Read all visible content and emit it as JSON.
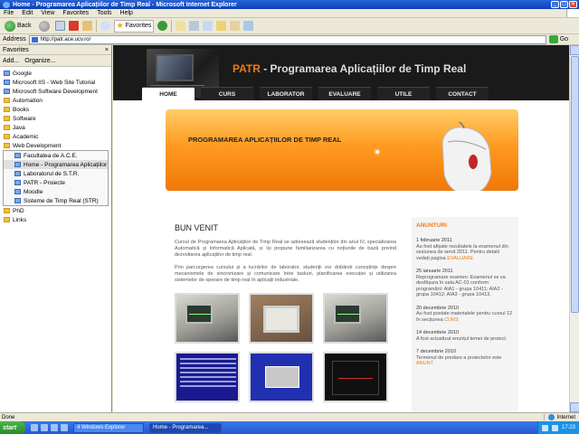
{
  "window": {
    "title": "Home - Programarea Aplicațiilor de Timp Real - Microsoft Internet Explorer"
  },
  "menu": [
    "File",
    "Edit",
    "View",
    "Favorites",
    "Tools",
    "Help"
  ],
  "toolbar": {
    "back": "Back",
    "favorites": "Favorites"
  },
  "address": {
    "label": "Address",
    "url": "http://patr.ace.ucv.ro/",
    "go": "Go"
  },
  "favorites_panel": {
    "title": "Favorites",
    "add": "Add...",
    "organize": "Organize...",
    "items": [
      {
        "label": "Google",
        "kind": "page",
        "sub": false
      },
      {
        "label": "Microsoft IIS - Web Site Tutorial",
        "kind": "page",
        "sub": false
      },
      {
        "label": "Microsoft Software Development",
        "kind": "page",
        "sub": false
      },
      {
        "label": "Automation",
        "kind": "folder",
        "sub": false
      },
      {
        "label": "Books",
        "kind": "folder",
        "sub": false
      },
      {
        "label": "Software",
        "kind": "folder",
        "sub": false
      },
      {
        "label": "Java",
        "kind": "folder",
        "sub": false
      },
      {
        "label": "Academic",
        "kind": "folder",
        "sub": false
      },
      {
        "label": "Web Development",
        "kind": "folder",
        "sub": false
      }
    ],
    "subitems": [
      {
        "label": "Facultatea de A.C.E.",
        "selected": false
      },
      {
        "label": "Home - Programarea Aplicațiilor de Timp Real",
        "selected": true
      },
      {
        "label": "Laboratorul de S.T.R.",
        "selected": false
      },
      {
        "label": "PATR - Proiecte",
        "selected": false
      },
      {
        "label": "Moodle",
        "selected": false
      },
      {
        "label": "Sisteme de Timp Real (STR)",
        "selected": false
      }
    ],
    "tail": [
      {
        "label": "PhD",
        "kind": "folder"
      },
      {
        "label": "Links",
        "kind": "folder"
      }
    ]
  },
  "site": {
    "title_acronym": "PATR",
    "title_rest": " - Programarea Aplicațiilor de Timp Real",
    "nav": [
      "HOME",
      "CURS",
      "LABORATOR",
      "EVALUARE",
      "UTILE",
      "CONTACT"
    ],
    "banner_text": "PROGRAMAREA APLICAȚIILOR DE TIMP REAL",
    "welcome_title": "BUN VENIT",
    "para1": "Cursul de Programarea Aplicațiilor de Timp Real se adresează studenților din anul IV, specializarea Automatică și Informatică Aplicată, și își propune familiarizarea cu noțiunile de bază privind dezvoltarea aplicațiilor de timp real.",
    "para2": "Prin parcurgerea cursului și a lucrărilor de laborator, studenții vor dobândi cunoștințe despre mecanismele de sincronizare și comunicare între taskuri, planificarea execuției și utilizarea sistemelor de operare de timp real în aplicații industriale.",
    "news_title": "ANUNTURI",
    "news": [
      {
        "date": "1 februarie 2011",
        "body": "Au fost afișate rezultatele la examenul din sesiunea de iarnă 2011. Pentru detalii vedeți pagina ",
        "link": "EVALUARE"
      },
      {
        "date": "25 ianuarie 2011",
        "body": "Reprogramare examen: Examenul se va desfășura în sala AC-01 conform programării: AIA1 - grupa 10411; AIA2 - grupa 10412; AIA3 - grupa 10413.",
        "link": ""
      },
      {
        "date": "20 decembrie 2010",
        "body": "Au fost postate materialele pentru cursul 12 în secțiunea ",
        "link": "CURS"
      },
      {
        "date": "14 decembrie 2010",
        "body": "A fost actualizat enunțul temei de proiect.",
        "link": ""
      },
      {
        "date": "7 decembrie 2010",
        "body": "Termenul de predare a proiectelor este ",
        "link": "ANUNT"
      }
    ]
  },
  "status": {
    "text": "Done",
    "zone": "Internet"
  },
  "taskbar": {
    "start": "start",
    "tasks": [
      {
        "label": "4 Windows Explorer",
        "active": false
      },
      {
        "label": "Home - Programarea...",
        "active": true
      }
    ],
    "clock": "17:23"
  },
  "colors": {
    "accent": "#f07a10",
    "xp_blue": "#2458d0",
    "header_dark": "#1a1a1a"
  }
}
